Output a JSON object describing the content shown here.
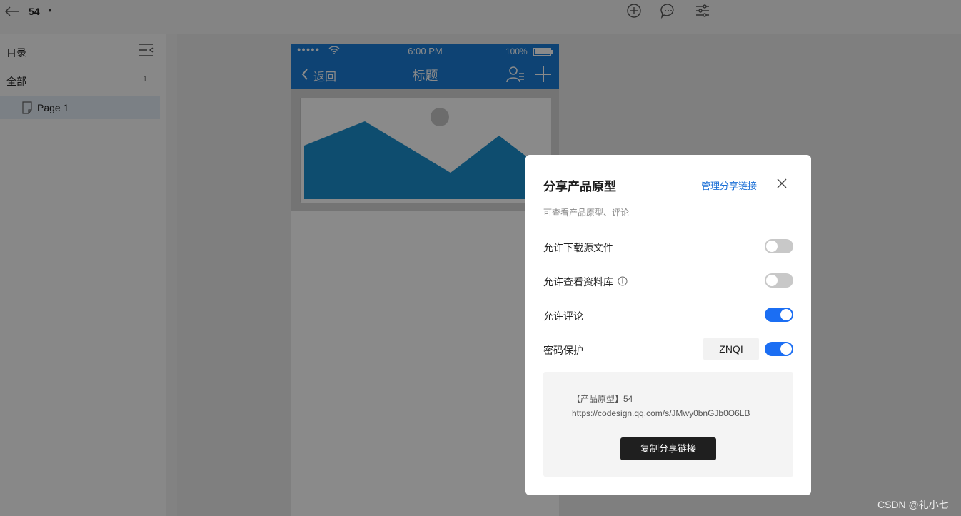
{
  "topbar": {
    "project_name": "54",
    "icons": [
      "back-arrow-icon",
      "add-circle-icon",
      "comment-icon",
      "settings-sliders-icon"
    ]
  },
  "sidebar": {
    "title": "目录",
    "all_label": "全部",
    "all_count": "1",
    "pages": [
      {
        "label": "Page 1"
      }
    ]
  },
  "phone": {
    "status_time": "6:00 PM",
    "status_battery": "100%",
    "nav_back": "返回",
    "nav_title": "标题",
    "colors": {
      "primary": "#1a7dd7"
    }
  },
  "dialog": {
    "title": "分享产品原型",
    "manage_link": "管理分享链接",
    "subtitle": "可查看产品原型、评论",
    "options": [
      {
        "label": "允许下载源文件",
        "enabled": false
      },
      {
        "label": "允许查看资料库",
        "enabled": false
      },
      {
        "label": "允许评论",
        "enabled": true
      },
      {
        "label": "密码保护",
        "enabled": true
      }
    ],
    "password": "ZNQI",
    "share_text": "【产品原型】54",
    "share_url": "https://codesign.qq.com/s/JMwy0bnGJb0O6LB",
    "copy_button": "复制分享链接",
    "colors": {
      "accent": "#1b6ef3",
      "link": "#1a6fd6"
    }
  },
  "watermark": "CSDN @礼小七"
}
